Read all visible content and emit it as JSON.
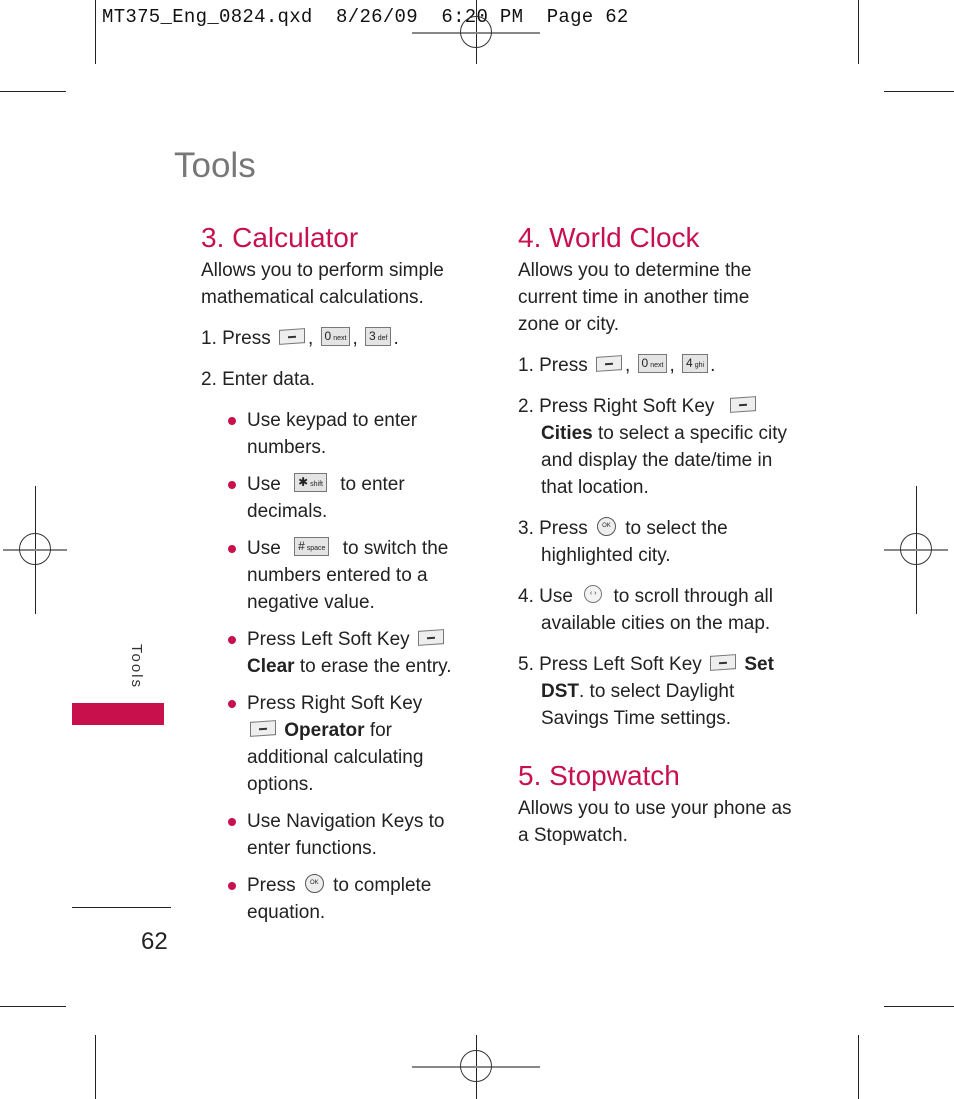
{
  "slug": {
    "file": "MT375_Eng_0824.qxd",
    "date": "8/26/09",
    "time": "6:20 PM",
    "page_label": "Page 62"
  },
  "page_title": "Tools",
  "side_tab": "Tools",
  "page_number": "62",
  "colors": {
    "accent": "#c8104d",
    "title_gray": "#777777"
  },
  "calculator": {
    "title": "3. Calculator",
    "intro": "Allows you to perform simple mathematical calculations.",
    "step1": {
      "prefix": "1. Press",
      "sep1": ",",
      "sep2": ",",
      "end": ".",
      "keys": [
        {
          "main": "0",
          "sub": "next"
        },
        {
          "main": "3",
          "sub": "def"
        }
      ]
    },
    "step2": "2. Enter data.",
    "bullets": [
      {
        "text": "Use keypad to enter numbers."
      },
      {
        "pre": "Use",
        "key_main": "✱",
        "key_sub": "shift",
        "post": "to enter decimals."
      },
      {
        "pre": "Use",
        "key_main": "#",
        "key_sub": "space",
        "post": "to switch the numbers entered to a negative value."
      },
      {
        "pre": "Press Left Soft Key",
        "bold": "Clear",
        "post": "to erase the entry."
      },
      {
        "pre": "Press Right Soft Key",
        "bold": "Operator",
        "post": "for additional calculating options."
      },
      {
        "text": "Use Navigation Keys to enter functions."
      },
      {
        "pre": "Press",
        "icon": "OK",
        "post": "to complete equation."
      }
    ]
  },
  "world_clock": {
    "title": "4. World Clock",
    "intro": "Allows you to determine the current time in another time zone or city.",
    "step1": {
      "prefix": "1. Press",
      "sep1": ",",
      "sep2": ",",
      "end": ".",
      "keys": [
        {
          "main": "0",
          "sub": "next"
        },
        {
          "main": "4",
          "sub": "ghi"
        }
      ]
    },
    "step2": {
      "pre": "2. Press Right Soft Key",
      "bold": "Cities",
      "post": "to select a specific city and display the date/time in that location."
    },
    "step3": {
      "pre": "3. Press",
      "icon": "OK",
      "post": "to select the highlighted city."
    },
    "step4": {
      "pre": "4. Use",
      "icon": "‹ ›",
      "post": "to scroll through all available cities on the map."
    },
    "step5": {
      "pre": "5. Press Left Soft Key",
      "bold1": "Set",
      "bold2": "DST",
      "post": ". to select Daylight Savings Time settings."
    }
  },
  "stopwatch": {
    "title": "5. Stopwatch",
    "intro": "Allows you to use your phone as a Stopwatch."
  }
}
